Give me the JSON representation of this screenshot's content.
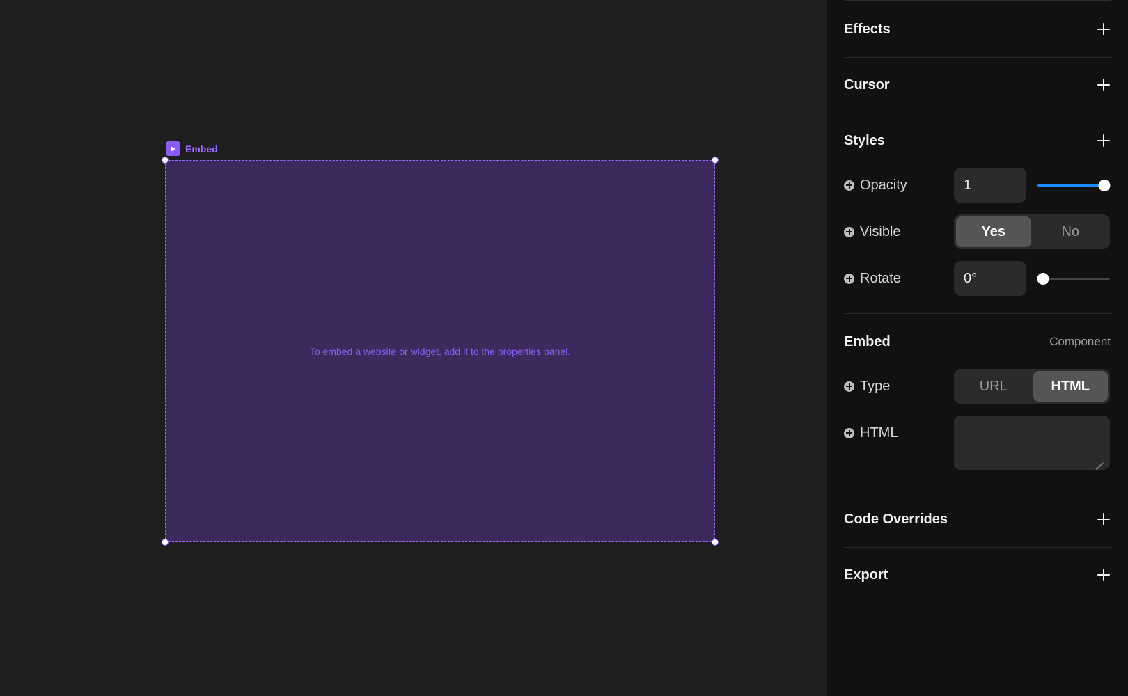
{
  "canvas": {
    "frame_label": "Embed",
    "hint": "To embed a website or widget, add it to the properties panel."
  },
  "panel": {
    "effects": {
      "title": "Effects"
    },
    "cursor": {
      "title": "Cursor"
    },
    "styles": {
      "title": "Styles",
      "opacity": {
        "label": "Opacity",
        "value": "1",
        "slider_fraction": 1.0
      },
      "visible": {
        "label": "Visible",
        "options": [
          "Yes",
          "No"
        ],
        "selected": "Yes"
      },
      "rotate": {
        "label": "Rotate",
        "value": "0°",
        "slider_fraction": 0.0
      }
    },
    "embed": {
      "title": "Embed",
      "component_label": "Component",
      "type": {
        "label": "Type",
        "options": [
          "URL",
          "HTML"
        ],
        "selected": "HTML"
      },
      "html": {
        "label": "HTML",
        "value": ""
      }
    },
    "code_overrides": {
      "title": "Code Overrides"
    },
    "export": {
      "title": "Export"
    }
  },
  "colors": {
    "accent_purple": "#8b5cf6",
    "frame_fill": "#3d2a5c",
    "slider_blue": "#1a8cff"
  }
}
